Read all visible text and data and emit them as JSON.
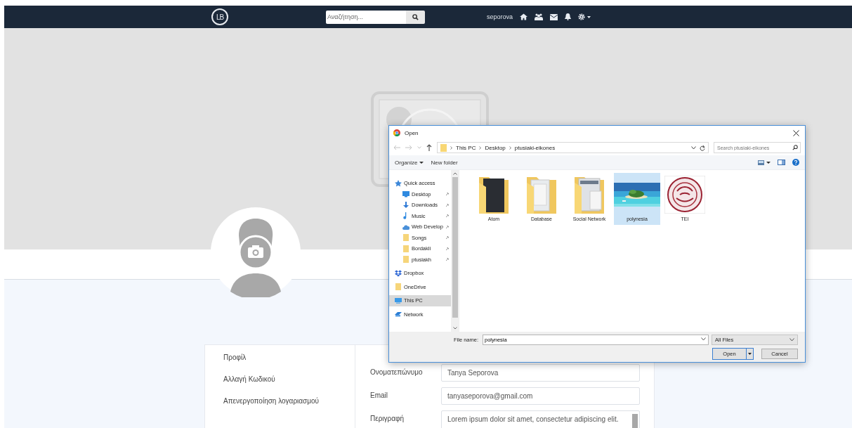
{
  "navbar": {
    "logo": "LB",
    "search": {
      "placeholder": "Αναζήτηση..."
    },
    "username": "seporova"
  },
  "profile": {
    "menu": [
      {
        "label": "Προφίλ"
      },
      {
        "label": "Αλλαγή Κωδικού"
      },
      {
        "label": "Απενεργοποίηση λογαριασμού"
      }
    ],
    "fields": [
      {
        "label": "Ονοματεπώνυμο",
        "value": "Tanya Seporova",
        "kind": "input"
      },
      {
        "label": "Email",
        "value": "tanyaseporova@gmail.com",
        "kind": "input"
      },
      {
        "label": "Περιγραφή",
        "value": "Lorem ipsum dolor sit amet, consectetur adipiscing elit.",
        "kind": "textarea"
      }
    ]
  },
  "dialog": {
    "title": "Open",
    "breadcrumbs": [
      "This PC",
      "Desktop",
      "ptusiaki-eikones"
    ],
    "search": {
      "placeholder": "Search ptusiaki-eikones"
    },
    "toolbar": {
      "organize": "Organize",
      "new_folder": "New folder"
    },
    "nav": [
      {
        "label": "Quick access",
        "kind": "star",
        "pinned": false,
        "selected": false
      },
      {
        "label": "Desktop",
        "kind": "desktop",
        "pinned": true,
        "selected": false
      },
      {
        "label": "Downloads",
        "kind": "download",
        "pinned": true,
        "selected": false
      },
      {
        "label": "Music",
        "kind": "music",
        "pinned": true,
        "selected": false
      },
      {
        "label": "Web Develop",
        "kind": "cloud",
        "pinned": true,
        "selected": false
      },
      {
        "label": "Songs",
        "kind": "folder",
        "pinned": true,
        "selected": false
      },
      {
        "label": "Bordakli",
        "kind": "folder",
        "pinned": true,
        "selected": false
      },
      {
        "label": "ptusiakh",
        "kind": "folder",
        "pinned": true,
        "selected": false
      },
      {
        "label": "Dropbox",
        "kind": "dropbox",
        "pinned": false,
        "selected": false
      },
      {
        "label": "OneDrive",
        "kind": "folder",
        "pinned": false,
        "selected": false
      },
      {
        "label": "This PC",
        "kind": "pc",
        "pinned": false,
        "selected": true
      },
      {
        "label": "Network",
        "kind": "network",
        "pinned": false,
        "selected": false
      }
    ],
    "files": [
      {
        "name": "Atom",
        "kind": "folder",
        "selected": false
      },
      {
        "name": "Database",
        "kind": "folder",
        "selected": false
      },
      {
        "name": "Social Network",
        "kind": "folder",
        "selected": false
      },
      {
        "name": "polynesia",
        "selected": true
      },
      {
        "name": "TEI",
        "kind": "logo",
        "selected": false
      }
    ],
    "file_name": {
      "label": "File name:",
      "value": "polynesia"
    },
    "file_type": "All Files",
    "buttons": [
      {
        "label": "Open",
        "kind": "split"
      },
      {
        "label": "Cancel",
        "kind": "plain"
      }
    ]
  }
}
